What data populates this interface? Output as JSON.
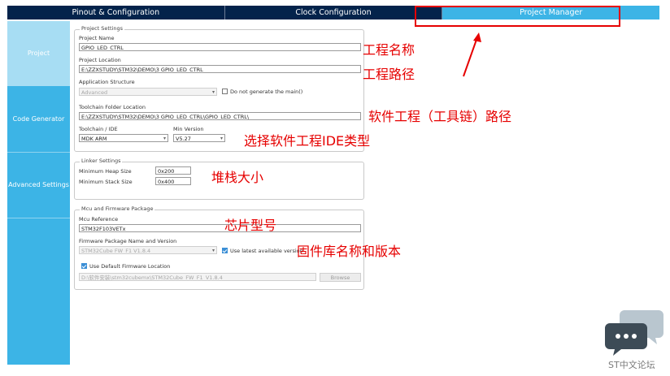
{
  "tabs": {
    "pinout": "Pinout & Configuration",
    "clock": "Clock Configuration",
    "project_manager": "Project Manager"
  },
  "sidebar": {
    "project": "Project",
    "code_generator": "Code Generator",
    "advanced": "Advanced Settings"
  },
  "project_settings": {
    "legend": "Project Settings",
    "name_label": "Project Name",
    "name_value": "GPIO_LED_CTRL",
    "location_label": "Project Location",
    "location_value": "E:\\ZZXSTUDY\\STM32\\DEMO\\3 GPIO_LED_CTRL",
    "structure_label": "Application Structure",
    "structure_value": "Advanced",
    "no_main_label": "Do not generate the main()",
    "toolchain_folder_label": "Toolchain Folder Location",
    "toolchain_folder_value": "E:\\ZZXSTUDY\\STM32\\DEMO\\3 GPIO_LED_CTRL\\GPIO_LED_CTRL\\",
    "ide_label": "Toolchain / IDE",
    "ide_value": "MDK ARM",
    "min_version_label": "Min Version",
    "min_version_value": "V5.27"
  },
  "linker_settings": {
    "legend": "Linker Settings",
    "heap_label": "Minimum Heap Size",
    "heap_value": "0x200",
    "stack_label": "Minimum Stack Size",
    "stack_value": "0x400"
  },
  "mcu": {
    "legend": "Mcu and Firmware Package",
    "ref_label": "Mcu Reference",
    "ref_value": "STM32F103VETx",
    "fw_label": "Firmware Package Name and Version",
    "fw_value": "STM32Cube FW_F1 V1.8.4",
    "latest_label": "Use latest available version",
    "default_loc_label": "Use Default Firmware Location",
    "fw_path": "D:\\软件安装\\stm32cubemx\\STM32Cube_FW_F1_V1.8.4",
    "browse": "Browse"
  },
  "annotations": {
    "name": "工程名称",
    "path": "工程路径",
    "toolchain": "软件工程（工具链）路径",
    "ide": "选择软件工程IDE类型",
    "stack": "堆栈大小",
    "chip": "芯片型号",
    "firmware": "固件库名称和版本"
  },
  "brand": "ST中文论坛",
  "colors": {
    "tab_bar": "#03234b",
    "accent": "#3cb4e6",
    "annotation": "#e60000"
  }
}
